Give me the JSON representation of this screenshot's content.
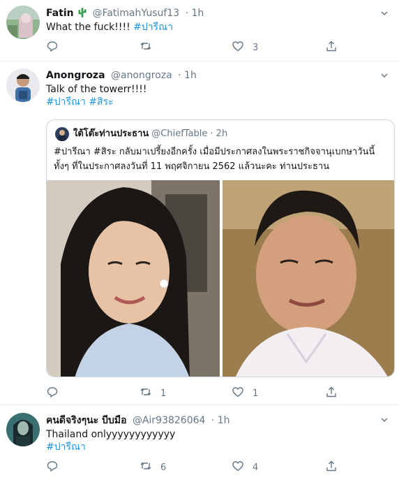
{
  "tweets": [
    {
      "name": "Fatin",
      "handle": "@FatimahYusuf13",
      "time": "· 1h",
      "text": "What the fuck!!!! ",
      "hashtag": "#ปารีณา",
      "reply_count": "",
      "retweet_count": "",
      "like_count": "3"
    },
    {
      "name": "Anongroza",
      "handle": "@anongroza",
      "time": "· 1h",
      "text": "Talk of the towerr!!!!",
      "hashtag": "#ปารีณา #สิระ",
      "reply_count": "",
      "retweet_count": "1",
      "like_count": "1",
      "quote": {
        "name": "ใต้โต๊ะท่านประธาน",
        "handle": "@ChiefTable",
        "time": "· 2h",
        "text": "#ปารีณา #สิระ กลับมาเปรี้ยงอีกครั้ง เมื่อมีประกาศลงในพระราชกิจจานุเบกษาวันนี้ ทั้งๆ ที่ในประกาศลงวันที่ 11 พฤศจิกายน 2562 แล้วนะคะ ท่านประธาน"
      }
    },
    {
      "name": "คนดีจริงๆนะ บีบมือ",
      "handle": "@Air93826064",
      "time": "· 1h",
      "text": "Thailand onlyyyyyyyyyyyy",
      "hashtag": "#ปารีณา",
      "reply_count": "",
      "retweet_count": "6",
      "like_count": "4"
    }
  ],
  "colors": {
    "accent": "#1b95e0",
    "muted": "#657786",
    "divider": "#e6ecf0",
    "verified_cactus": "#3ca155"
  },
  "icons": [
    "reply-icon",
    "retweet-icon",
    "like-icon",
    "share-icon",
    "caret-down-icon",
    "cactus-emoji"
  ]
}
